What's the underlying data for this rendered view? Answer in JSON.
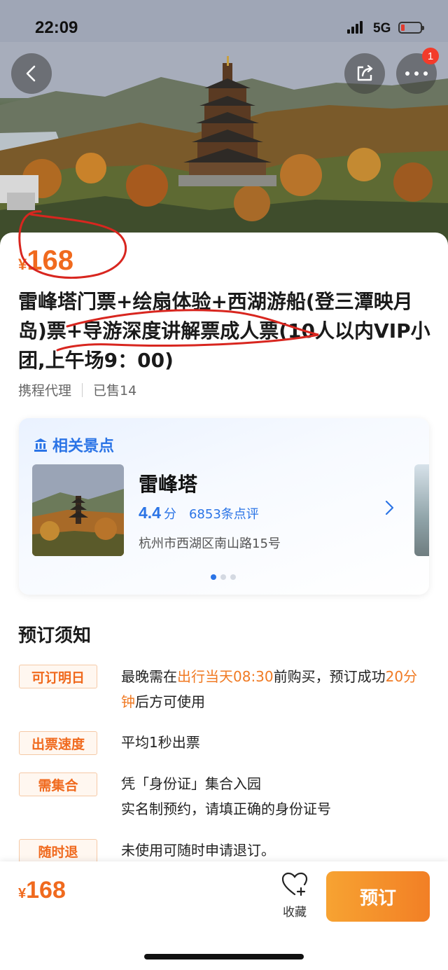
{
  "status_bar": {
    "time": "22:09",
    "network": "5G"
  },
  "header": {
    "badge_count": "1"
  },
  "product": {
    "currency": "¥",
    "price": "168",
    "title": "雷峰塔门票+绘扇体验+西湖游船(登三潭映月岛)票+导游深度讲解票成人票(10人以内VIP小团,上午场9：00)",
    "agent": "携程代理",
    "sold": "已售14"
  },
  "related_spot": {
    "section_label": "相关景点",
    "name": "雷峰塔",
    "score": "4.4",
    "score_unit": "分",
    "reviews": "6853条点评",
    "address": "杭州市西湖区南山路15号"
  },
  "notice": {
    "title": "预订须知",
    "items": [
      {
        "tag": "可订明日",
        "parts": [
          "最晚需在",
          "出行当天08:30",
          "前购买，预订成功",
          "20分钟",
          "后方可使用"
        ]
      },
      {
        "tag": "出票速度",
        "line1": "平均1秒出票"
      },
      {
        "tag": "需集合",
        "line1": "凭「身份证」集合入园",
        "line2": "实名制预约，请填正确的身份证号"
      },
      {
        "tag": "随时退",
        "line1": "未使用可随时申请退订。"
      }
    ]
  },
  "bottom_bar": {
    "currency": "¥",
    "price": "168",
    "favorite_label": "收藏",
    "book_label": "预订"
  },
  "colors": {
    "accent": "#f06a1e",
    "blue": "#2b74e6",
    "badge": "#f33b2a"
  }
}
